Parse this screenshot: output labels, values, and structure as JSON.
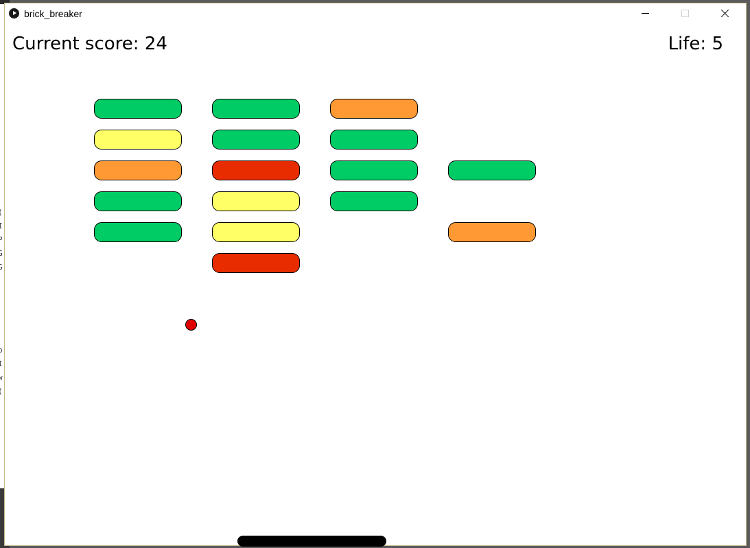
{
  "window": {
    "title": "brick_breaker"
  },
  "hud": {
    "score_text": "Current score: 24",
    "life_text": "Life: 5"
  },
  "game": {
    "score": 24,
    "lives": 5,
    "colors": {
      "green": "#00cc66",
      "yellow": "#ffff66",
      "orange": "#ff9933",
      "red": "#e82c00",
      "ball": "#e00000",
      "paddle": "#000000"
    },
    "brick_grid": {
      "columns": 4,
      "rows": 6,
      "cells": [
        [
          "green",
          "green",
          "orange",
          null
        ],
        [
          "yellow",
          "green",
          "green",
          null
        ],
        [
          "orange",
          "red",
          "green",
          "green"
        ],
        [
          "green",
          "yellow",
          "green",
          null
        ],
        [
          "green",
          "yellow",
          null,
          "orange"
        ],
        [
          null,
          "red",
          null,
          null
        ]
      ]
    }
  },
  "background_editor": {
    "visible_fragments": [
      "(",
      "I",
      "P",
      "G",
      "G",
      "p",
      "I",
      "w",
      "("
    ]
  }
}
